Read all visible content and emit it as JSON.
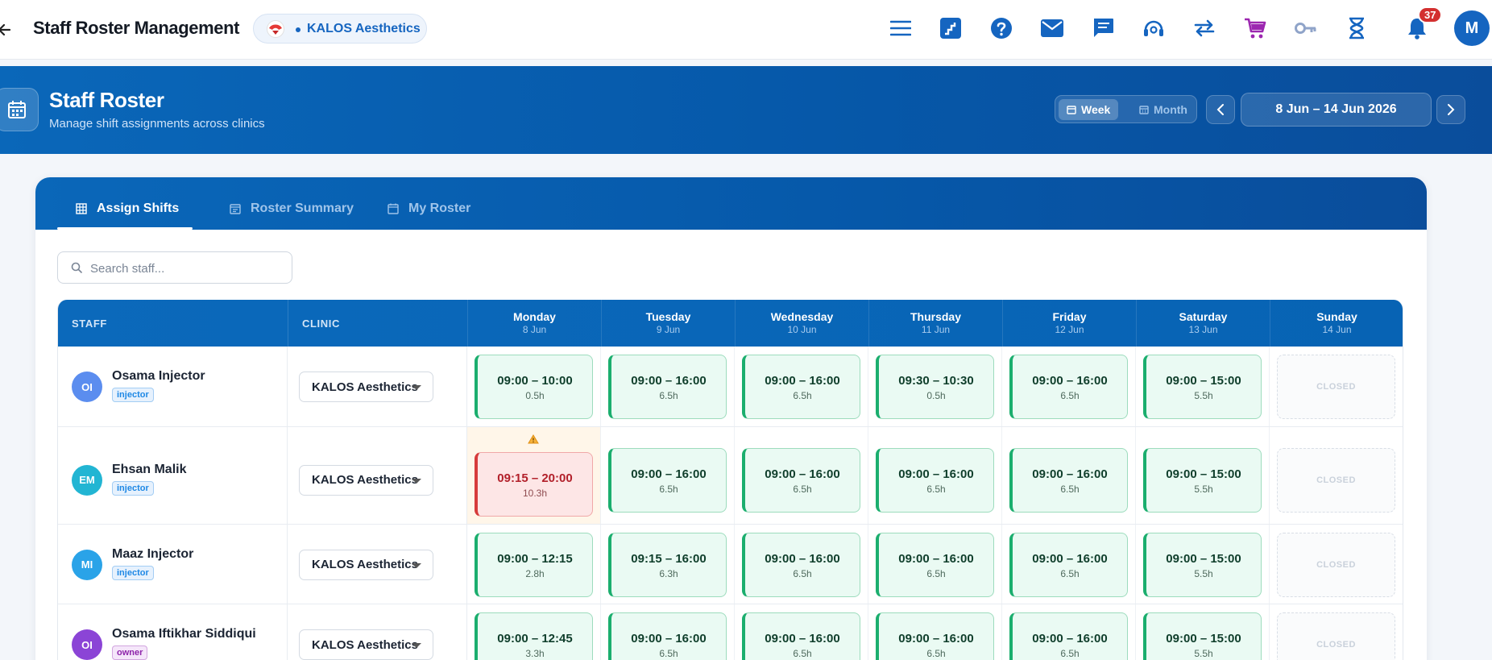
{
  "topbar": {
    "title": "Staff Roster Management",
    "clinic_chip": "KALOS Aesthetics",
    "notification_count": "37",
    "user_initial": "M",
    "icons": [
      "menu-icon",
      "stairs-icon",
      "help-icon",
      "mail-icon",
      "chat-icon",
      "support-icon",
      "swap-icon",
      "cart-icon",
      "key-icon",
      "hourglass-icon",
      "bell-icon"
    ]
  },
  "hero": {
    "title": "Staff Roster",
    "subtitle": "Manage shift assignments across clinics",
    "view_week": "Week",
    "view_month": "Month",
    "date_range": "8 Jun – 14 Jun 2026"
  },
  "tabs": [
    {
      "label": "Assign Shifts",
      "active": true
    },
    {
      "label": "Roster Summary",
      "active": false
    },
    {
      "label": "My Roster",
      "active": false
    }
  ],
  "search": {
    "placeholder": "Search staff..."
  },
  "table": {
    "col_staff": "STAFF",
    "col_clinic": "CLINIC",
    "days": [
      {
        "name": "Monday",
        "date": "8 Jun"
      },
      {
        "name": "Tuesday",
        "date": "9 Jun"
      },
      {
        "name": "Wednesday",
        "date": "10 Jun"
      },
      {
        "name": "Thursday",
        "date": "11 Jun"
      },
      {
        "name": "Friday",
        "date": "12 Jun"
      },
      {
        "name": "Saturday",
        "date": "13 Jun"
      },
      {
        "name": "Sunday",
        "date": "14 Jun"
      }
    ],
    "closed_label": "CLOSED",
    "rows": [
      {
        "initials": "OI",
        "name": "Osama Injector",
        "role": "injector",
        "clinic": "KALOS Aesthetics",
        "shifts": [
          {
            "time": "09:00 – 10:00",
            "hours": "0.5h"
          },
          {
            "time": "09:00 – 16:00",
            "hours": "6.5h"
          },
          {
            "time": "09:00 – 16:00",
            "hours": "6.5h"
          },
          {
            "time": "09:30 – 10:30",
            "hours": "0.5h"
          },
          {
            "time": "09:00 – 16:00",
            "hours": "6.5h"
          },
          {
            "time": "09:00 – 15:00",
            "hours": "5.5h"
          }
        ]
      },
      {
        "initials": "EM",
        "name": "Ehsan Malik",
        "role": "injector",
        "clinic": "KALOS Aesthetics",
        "shifts": [
          {
            "time": "09:15 – 20:00",
            "hours": "10.3h",
            "warning": true
          },
          {
            "time": "09:00 – 16:00",
            "hours": "6.5h"
          },
          {
            "time": "09:00 – 16:00",
            "hours": "6.5h"
          },
          {
            "time": "09:00 – 16:00",
            "hours": "6.5h"
          },
          {
            "time": "09:00 – 16:00",
            "hours": "6.5h"
          },
          {
            "time": "09:00 – 15:00",
            "hours": "5.5h"
          }
        ]
      },
      {
        "initials": "MI",
        "name": "Maaz Injector",
        "role": "injector",
        "clinic": "KALOS Aesthetics",
        "shifts": [
          {
            "time": "09:00 – 12:15",
            "hours": "2.8h"
          },
          {
            "time": "09:15 – 16:00",
            "hours": "6.3h"
          },
          {
            "time": "09:00 – 16:00",
            "hours": "6.5h"
          },
          {
            "time": "09:00 – 16:00",
            "hours": "6.5h"
          },
          {
            "time": "09:00 – 16:00",
            "hours": "6.5h"
          },
          {
            "time": "09:00 – 15:00",
            "hours": "5.5h"
          }
        ]
      },
      {
        "initials": "OI",
        "name": "Osama Iftikhar Siddiqui",
        "role": "owner",
        "clinic": "KALOS Aesthetics",
        "shifts": [
          {
            "time": "09:00 – 12:45",
            "hours": "3.3h"
          },
          {
            "time": "09:00 – 16:00",
            "hours": "6.5h"
          },
          {
            "time": "09:00 – 16:00",
            "hours": "6.5h"
          },
          {
            "time": "09:00 – 16:00",
            "hours": "6.5h"
          },
          {
            "time": "09:00 – 16:00",
            "hours": "6.5h"
          },
          {
            "time": "09:00 – 15:00",
            "hours": "5.5h"
          }
        ]
      }
    ]
  },
  "colors": {
    "primary": "#0a67b9",
    "shift_ok": "#1bae6e",
    "shift_over": "#d63b3b",
    "badge": "#d32f2f",
    "avatars": [
      "#5b8def",
      "#22b5d3",
      "#2aa3e8",
      "#8b44d6"
    ],
    "role_injector": "#1e88e5",
    "role_owner": "#8e24aa"
  }
}
